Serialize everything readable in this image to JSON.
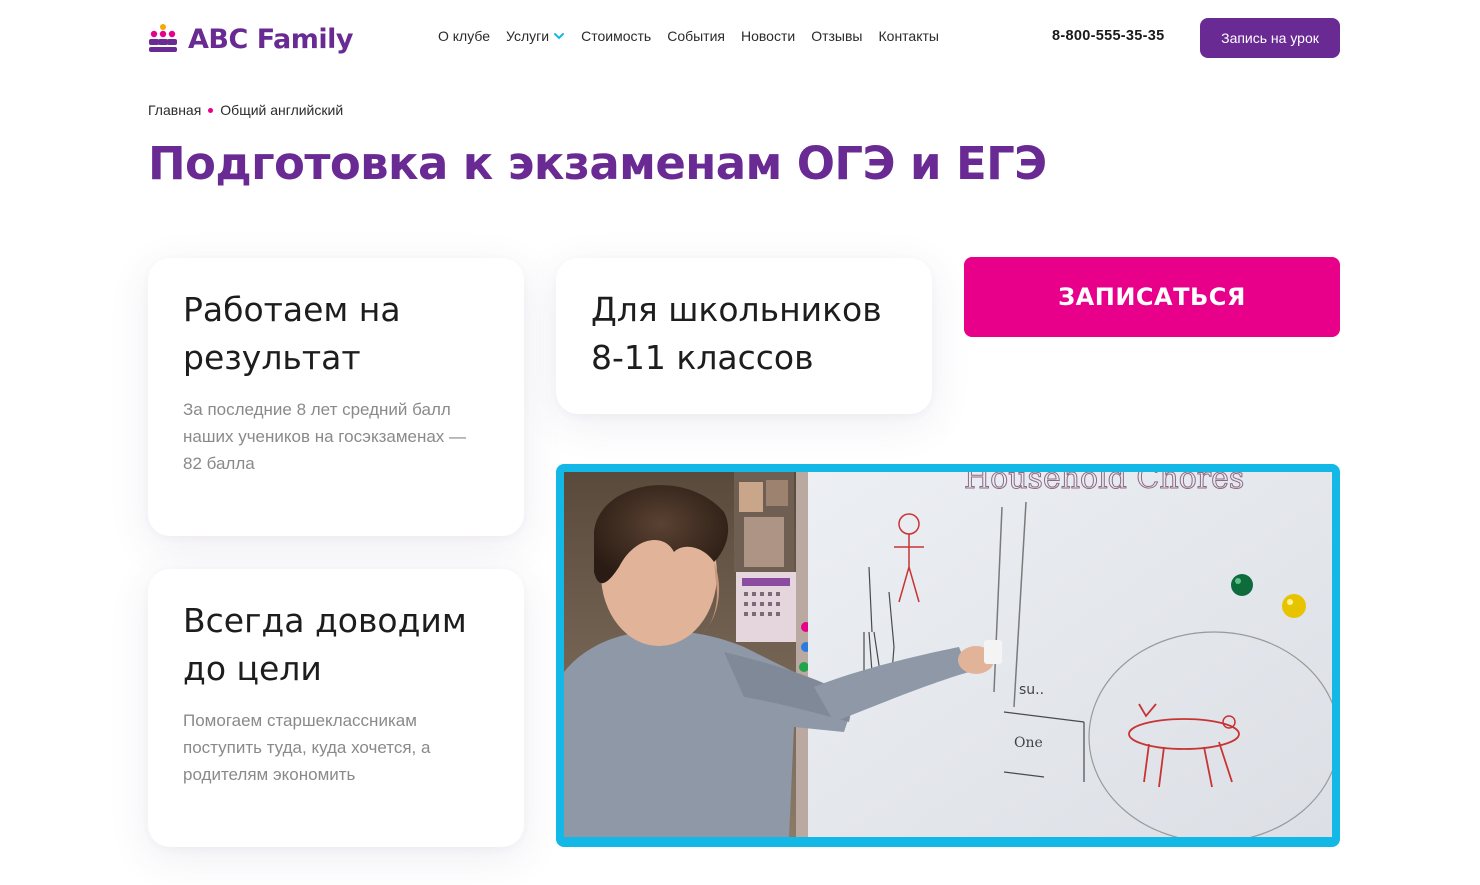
{
  "header": {
    "logo_text": "ABC Family",
    "nav": [
      {
        "label": "О клубе"
      },
      {
        "label": "Услуги",
        "has_dropdown": true
      },
      {
        "label": "Стоимость"
      },
      {
        "label": "События"
      },
      {
        "label": "Новости"
      },
      {
        "label": "Отзывы"
      },
      {
        "label": "Контакты"
      }
    ],
    "phone": "8-800-555-35-35",
    "cta_label": "Запись на урок"
  },
  "breadcrumb": {
    "home": "Главная",
    "current": "Общий английский"
  },
  "page": {
    "title": "Подготовка к экзаменам ОГЭ и ЕГЭ"
  },
  "cards": [
    {
      "title": "Работаем на результат",
      "text": "За последние 8 лет средний балл наших учеников на госэкзаменах — 82 балла"
    },
    {
      "title": "Для школьников 8-11 классов",
      "text": ""
    },
    {
      "title": "Всегда доводим до цели",
      "text": "Помогаем старшеклассникам поступить туда, куда хочется, а родителям экономить"
    }
  ],
  "signup_label": "ЗАПИСАТЬСЯ",
  "colors": {
    "brand_purple": "#6a2a93",
    "accent_pink": "#e8008a",
    "photo_border": "#14b8e6"
  },
  "photo": {
    "board_text": "Household Chores",
    "board_word_1": "su..",
    "board_word_2": "One"
  }
}
